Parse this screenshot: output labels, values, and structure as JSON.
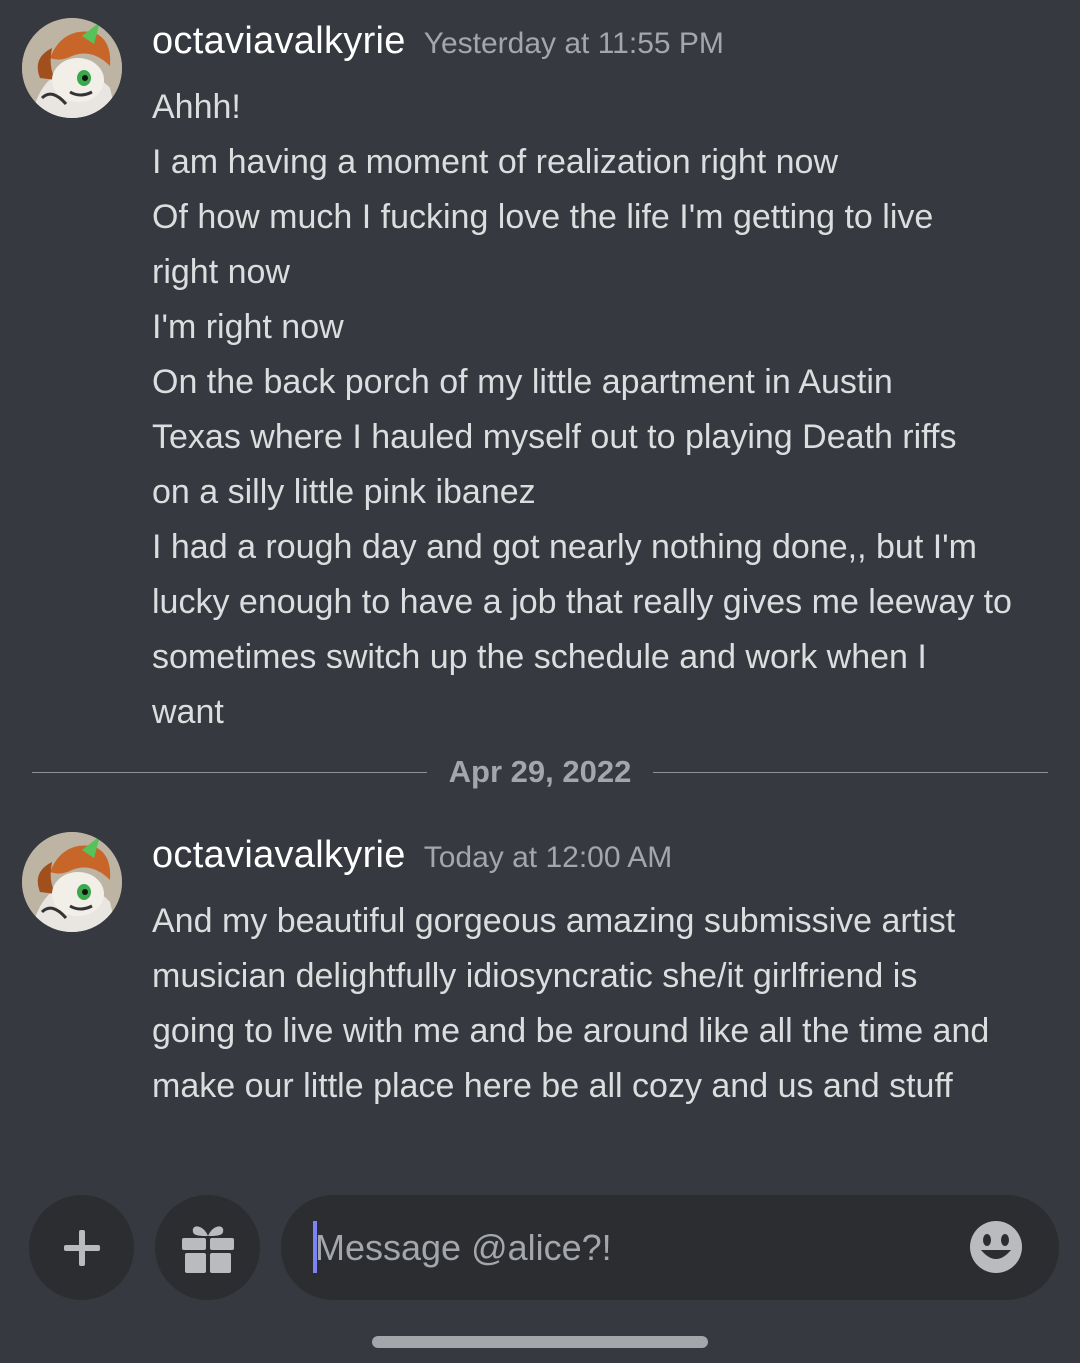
{
  "messages": [
    {
      "username": "octaviavalkyrie",
      "timestamp": "Yesterday at 11:55 PM",
      "lines": [
        "Ahhh!",
        "I am having a moment of realization right now",
        "Of how much I fucking love the life I'm getting to live",
        "right now",
        "I'm right now",
        "On the back porch of my little apartment in Austin",
        "Texas where I hauled myself out to playing Death riffs",
        "on a silly little pink ibanez",
        "I had a rough day and got nearly nothing done,, but I'm",
        "lucky enough to have a job that really gives me leeway to",
        "sometimes switch up the schedule and work when I",
        "want"
      ]
    },
    {
      "username": "octaviavalkyrie",
      "timestamp": "Today at 12:00 AM",
      "lines": [
        "And my beautiful gorgeous amazing submissive artist",
        "musician delightfully idiosyncratic she/it girlfriend is",
        "going to live with me and be around like all the time and",
        "make our little place here be all cozy and us and stuff"
      ]
    }
  ],
  "divider": {
    "date": "Apr 29, 2022"
  },
  "composer": {
    "placeholder": "Message @alice?!",
    "icons": [
      "plus-icon",
      "gift-icon",
      "emoji-icon"
    ]
  },
  "colors": {
    "background": "#36393f",
    "input_background": "#2b2d31",
    "username": "#ffffff",
    "message_text": "#dcddde",
    "muted_text": "#a3a6aa",
    "caret": "#7c84f3"
  }
}
